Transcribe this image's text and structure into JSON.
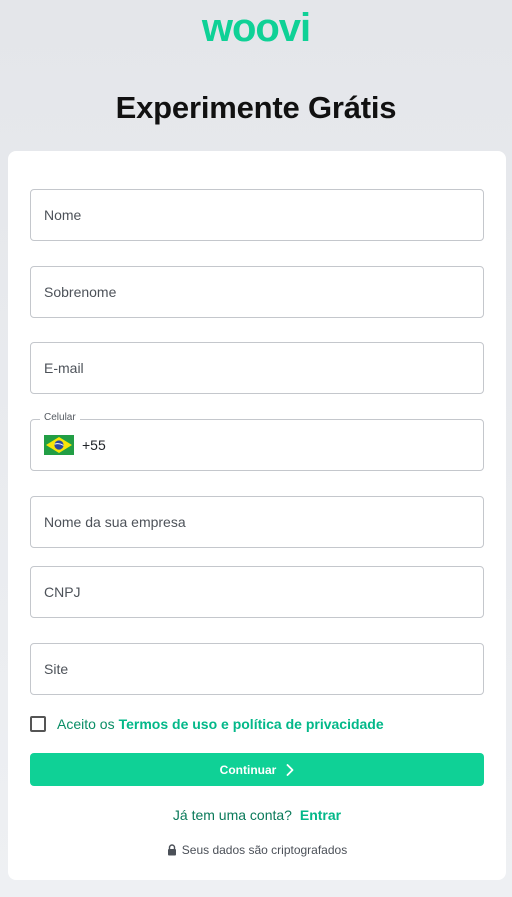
{
  "brand": {
    "logo_text": "woovi",
    "color": "#0fd196"
  },
  "page_title": "Experimente Grátis",
  "form": {
    "first_name_placeholder": "Nome",
    "last_name_placeholder": "Sobrenome",
    "email_placeholder": "E-mail",
    "phone": {
      "label": "Celular",
      "country_flag": "brazil-flag-icon",
      "ddi": "+55"
    },
    "company_placeholder": "Nome da sua empresa",
    "cnpj_placeholder": "CNPJ",
    "site_placeholder": "Site"
  },
  "terms": {
    "checked": false,
    "prefix": "Aceito os",
    "link_text": "Termos de uso e política de privacidade"
  },
  "continue_button": {
    "label": "Continuar",
    "icon": "chevron-right-icon"
  },
  "login": {
    "question": "Já tem uma conta?",
    "link_text": "Entrar"
  },
  "security_note": {
    "icon": "lock-icon",
    "text": "Seus dados são criptografados"
  }
}
